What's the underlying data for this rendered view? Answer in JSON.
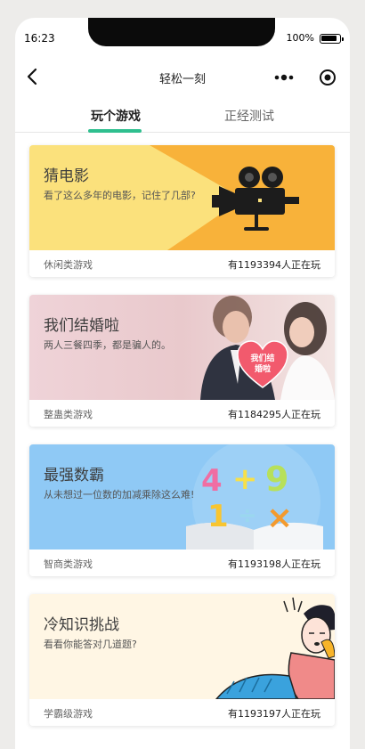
{
  "status_bar": {
    "time": "16:23",
    "battery": "100%"
  },
  "nav": {
    "title": "轻松一刻"
  },
  "tabs": [
    {
      "label": "玩个游戏",
      "active": true
    },
    {
      "label": "正经测试",
      "active": false
    }
  ],
  "cards": [
    {
      "title": "猜电影",
      "desc": "看了这么多年的电影，记住了几部?",
      "category": "休闲类游戏",
      "players": "有1193394人正在玩",
      "bg_color": "#fbe17c"
    },
    {
      "title": "我们结婚啦",
      "desc": "两人三餐四季，都是骗人的。",
      "category": "整蛊类游戏",
      "players": "有1184295人正在玩",
      "bg_color": "#efd3d8",
      "badge_text": "我们结婚啦"
    },
    {
      "title": "最强数霸",
      "desc": "从未想过一位数的加减乘除这么难!",
      "category": "智商类游戏",
      "players": "有1193198人正在玩",
      "bg_color": "#8fc9f5"
    },
    {
      "title": "冷知识挑战",
      "desc": "看看你能答对几道题?",
      "category": "学霸级游戏",
      "players": "有1193197人正在玩",
      "bg_color": "#fff6e4"
    }
  ],
  "colors": {
    "accent": "#2fbf8f"
  }
}
